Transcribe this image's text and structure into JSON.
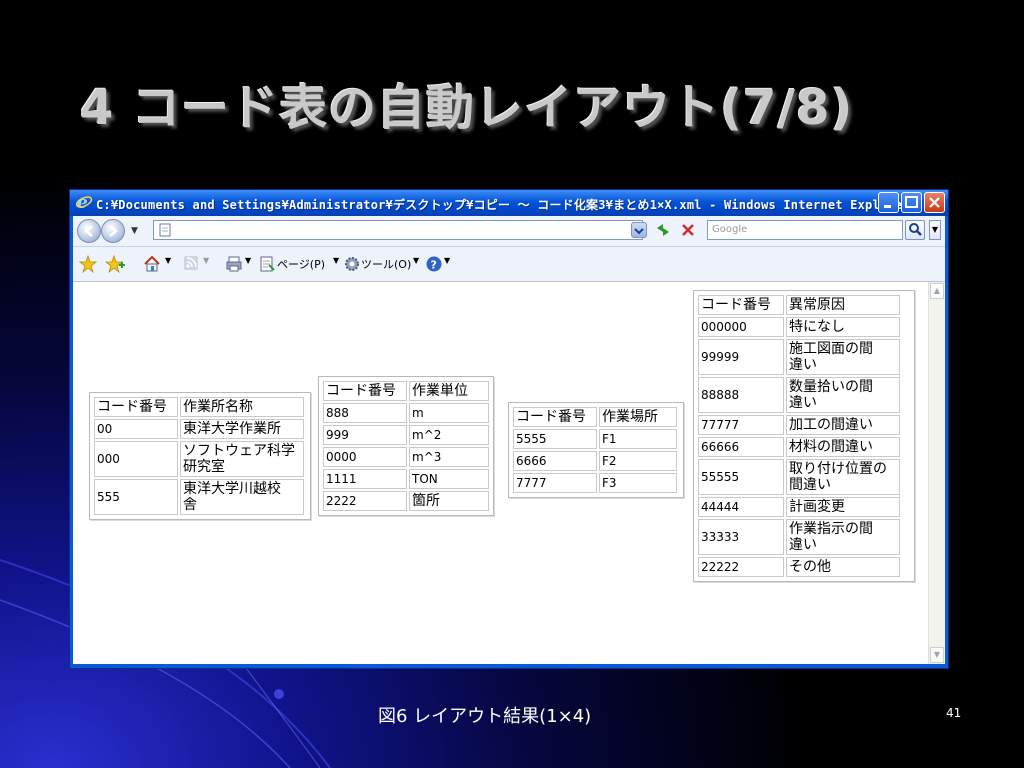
{
  "slide": {
    "title": "4 コード表の自動レイアウト(7/8)",
    "caption": "図6 レイアウト結果(1×4)",
    "page_number": "41"
  },
  "browser": {
    "title": "C:¥Documents and Settings¥Administrator¥デスクトップ¥コピー ～ コード化案3¥まとめ1×X.xml - Windows Internet Explorer",
    "address_value": "",
    "search_placeholder": "Google",
    "toolbar": {
      "page_label": "ページ(P)",
      "tools_label": "ツール(O)"
    },
    "icons": [
      "ie-logo-icon",
      "back-icon",
      "forward-icon",
      "page-icon",
      "refresh-icon",
      "stop-icon",
      "search-icon",
      "favorites-star-icon",
      "add-favorites-icon",
      "home-icon",
      "feeds-icon",
      "print-icon",
      "page-menu-icon",
      "tools-gear-icon",
      "help-icon"
    ]
  },
  "tables": [
    {
      "rows": [
        [
          "コード番号",
          "作業所名称"
        ],
        [
          "00",
          "東洋大学作業所"
        ],
        [
          "000",
          "ソフトウェア科学\n研究室"
        ],
        [
          "555",
          "東洋大学川越校\n舎"
        ]
      ]
    },
    {
      "rows": [
        [
          "コード番号",
          "作業単位"
        ],
        [
          "888",
          "m"
        ],
        [
          "999",
          "m^2"
        ],
        [
          "0000",
          "m^3"
        ],
        [
          "1111",
          "TON"
        ],
        [
          "2222",
          "箇所"
        ]
      ]
    },
    {
      "rows": [
        [
          "コード番号",
          "作業場所"
        ],
        [
          "5555",
          "F1"
        ],
        [
          "6666",
          "F2"
        ],
        [
          "7777",
          "F3"
        ]
      ]
    },
    {
      "rows": [
        [
          "コード番号",
          "異常原因"
        ],
        [
          "000000",
          "特になし"
        ],
        [
          "99999",
          "施工図面の間\n違い"
        ],
        [
          "88888",
          "数量拾いの間\n違い"
        ],
        [
          "77777",
          "加工の間違い"
        ],
        [
          "66666",
          "材料の間違い"
        ],
        [
          "55555",
          "取り付け位置の\n間違い"
        ],
        [
          "44444",
          "計画変更"
        ],
        [
          "33333",
          "作業指示の間\n違い"
        ],
        [
          "22222",
          "その他"
        ]
      ]
    }
  ],
  "colors": {
    "titlebar": "#0654d6",
    "close_button": "#c73a17",
    "slide_title": "#c9c9c9"
  }
}
